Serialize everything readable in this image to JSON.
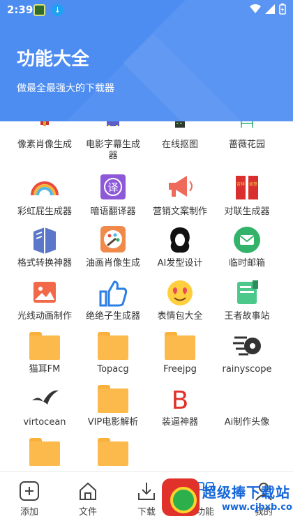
{
  "status": {
    "time": "2:39"
  },
  "header": {
    "title": "功能大全",
    "subtitle": "做最全最强大的下载器"
  },
  "colors": {
    "header_bg": "#4d8df2",
    "folder": "#fbba4b",
    "watermark": "#1667d9"
  },
  "grid": {
    "rows": [
      [
        "像素肖像生成",
        "电影字幕生成器",
        "在线抠图",
        "蔷薇花园"
      ],
      [
        "彩虹屁生成器",
        "暗语翻译器",
        "营销文案制作",
        "对联生成器"
      ],
      [
        "格式转换神器",
        "油画肖像生成",
        "AI发型设计",
        "临时邮箱"
      ],
      [
        "光线动画制作",
        "绝绝子生成器",
        "表情包大全",
        "王者故事站"
      ],
      [
        "猫耳FM",
        "Topacg",
        "Freejpg",
        "rainyscope"
      ],
      [
        "virtocean",
        "VIP电影解析",
        "装逼神器",
        "Ai制作头像"
      ]
    ],
    "row1": [
      "像素肖像生成",
      "电影字幕生成\n器",
      "在线抠图",
      "蔷薇花园"
    ],
    "row2": [
      "彩虹屁生成器",
      "暗语翻译器",
      "营销文案制作",
      "对联生成器"
    ],
    "row3": [
      "格式转换神器",
      "油画肖像生成",
      "AI发型设计",
      "临时邮箱"
    ],
    "row4": [
      "光线动画制作",
      "绝绝子生成器",
      "表情包大全",
      "王者故事站"
    ],
    "row5": [
      "猫耳FM",
      "Topacg",
      "Freejpg",
      "rainyscope"
    ],
    "row6": [
      "virtocean",
      "VIP电影解析",
      "装逼神器",
      "Ai制作头像"
    ],
    "icon_names": [
      "translate-icon",
      "megaphone-icon",
      "couplet-icon",
      "book-icon",
      "palette-icon",
      "hair-icon",
      "mail-icon",
      "photo-icon",
      "thumbs-up-icon",
      "emoji-icon",
      "story-icon",
      "folder-icon",
      "speed-icon",
      "bird-icon",
      "b-letter-icon"
    ]
  },
  "bottom_nav": {
    "add": "添加",
    "files": "文件",
    "download": "下载",
    "func": "功能",
    "mine": "我的"
  },
  "watermark": {
    "main": "超级捧下载站",
    "sub": "www.cjbxb.com"
  }
}
